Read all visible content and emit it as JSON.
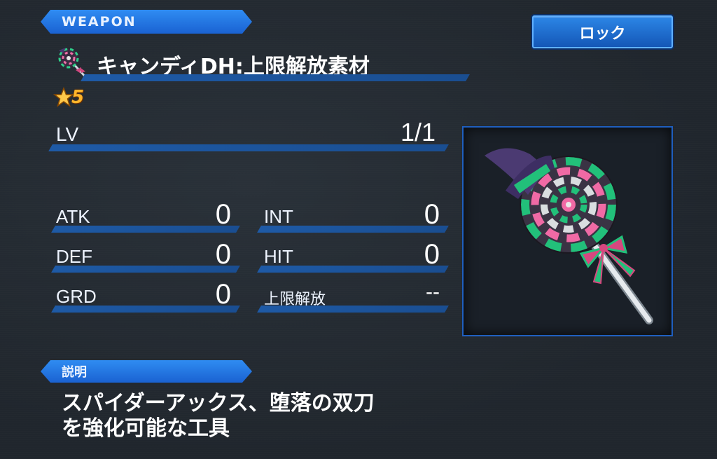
{
  "header": {
    "tab_label": "WEAPON"
  },
  "lock_button": {
    "label": "ロック"
  },
  "item": {
    "name": "キャンディDH:上限解放素材",
    "rarity": "5",
    "icon": "lollipop-icon"
  },
  "level": {
    "label": "LV",
    "value": "1/1"
  },
  "stats": {
    "atk": {
      "label": "ATK",
      "value": "0"
    },
    "def": {
      "label": "DEF",
      "value": "0"
    },
    "grd": {
      "label": "GRD",
      "value": "0"
    },
    "int": {
      "label": "INT",
      "value": "0"
    },
    "hit": {
      "label": "HIT",
      "value": "0"
    },
    "limit_break": {
      "label": "上限解放",
      "value": "--"
    }
  },
  "description": {
    "tab_label": "説明",
    "text": "スパイダーアックス、堕落の双刀\nを強化可能な工具"
  },
  "colors": {
    "accent_blue": "#1a62d2",
    "panel_bg": "#20262d",
    "rarity_gold": "#ffb52b"
  }
}
